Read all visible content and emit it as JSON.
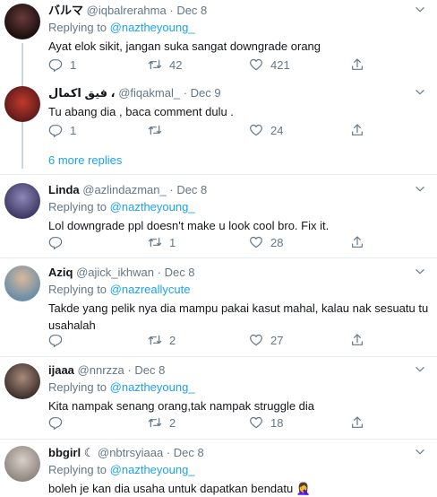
{
  "replying_to_label": "Replying to",
  "more_replies": "6 more replies",
  "tweets": [
    {
      "name": "バルマ",
      "handle": "@iqbalrerahma",
      "date": "Dec 8",
      "replying_to": "@naztheyoung_",
      "text": "Ayat elok sikit, jangan suka sangat downgrade orang",
      "replies": "1",
      "retweets": "42",
      "likes": "421"
    },
    {
      "name": "فيق اكمال ،",
      "handle": "@fiqakmal_",
      "date": "Dec 9",
      "text": "Tu abang dia , baca comment dulu .",
      "replies": "1",
      "retweets": "",
      "likes": "24"
    },
    {
      "name": "Linda",
      "handle": "@azlindazman_",
      "date": "Dec 8",
      "replying_to": "@naztheyoung_",
      "text": "Lol downgrade ppl doesn't make u look cool bro. Fix it.",
      "replies": "",
      "retweets": "1",
      "likes": "28"
    },
    {
      "name": "Aziq",
      "handle": "@ajick_ikhwan",
      "date": "Dec 8",
      "replying_to": "@nazreallycute",
      "text_line1": "Takde yang pelik nya dia mampu pakai kasut mahal, kalau nak sesuatu tu",
      "text_line2": "usahalah",
      "replies": "",
      "retweets": "2",
      "likes": "27"
    },
    {
      "name": "ijaaa",
      "handle": "@nnrzza",
      "date": "Dec 8",
      "replying_to": "@naztheyoung_",
      "text": "Kita nampak senang orang,tak nampak struggle dia",
      "replies": "",
      "retweets": "2",
      "likes": "18"
    },
    {
      "name": "bbgirl ☾",
      "handle": "@nbtrsyiaaa",
      "date": "Dec 8",
      "replying_to": "@naztheyoung_",
      "text": "boleh je kan dia usaha untuk dapatkan bendatu 🤦‍♀️"
    }
  ],
  "icons": {
    "reply": "reply-icon",
    "retweet": "retweet-icon",
    "like": "heart-icon",
    "share": "share-icon",
    "menu": "chevron-down-icon"
  },
  "colors": {
    "link": "#1da1f2",
    "muted": "#657786",
    "text": "#14171a",
    "divider": "#e6ecf0",
    "thread_line": "#ccd6dd"
  }
}
